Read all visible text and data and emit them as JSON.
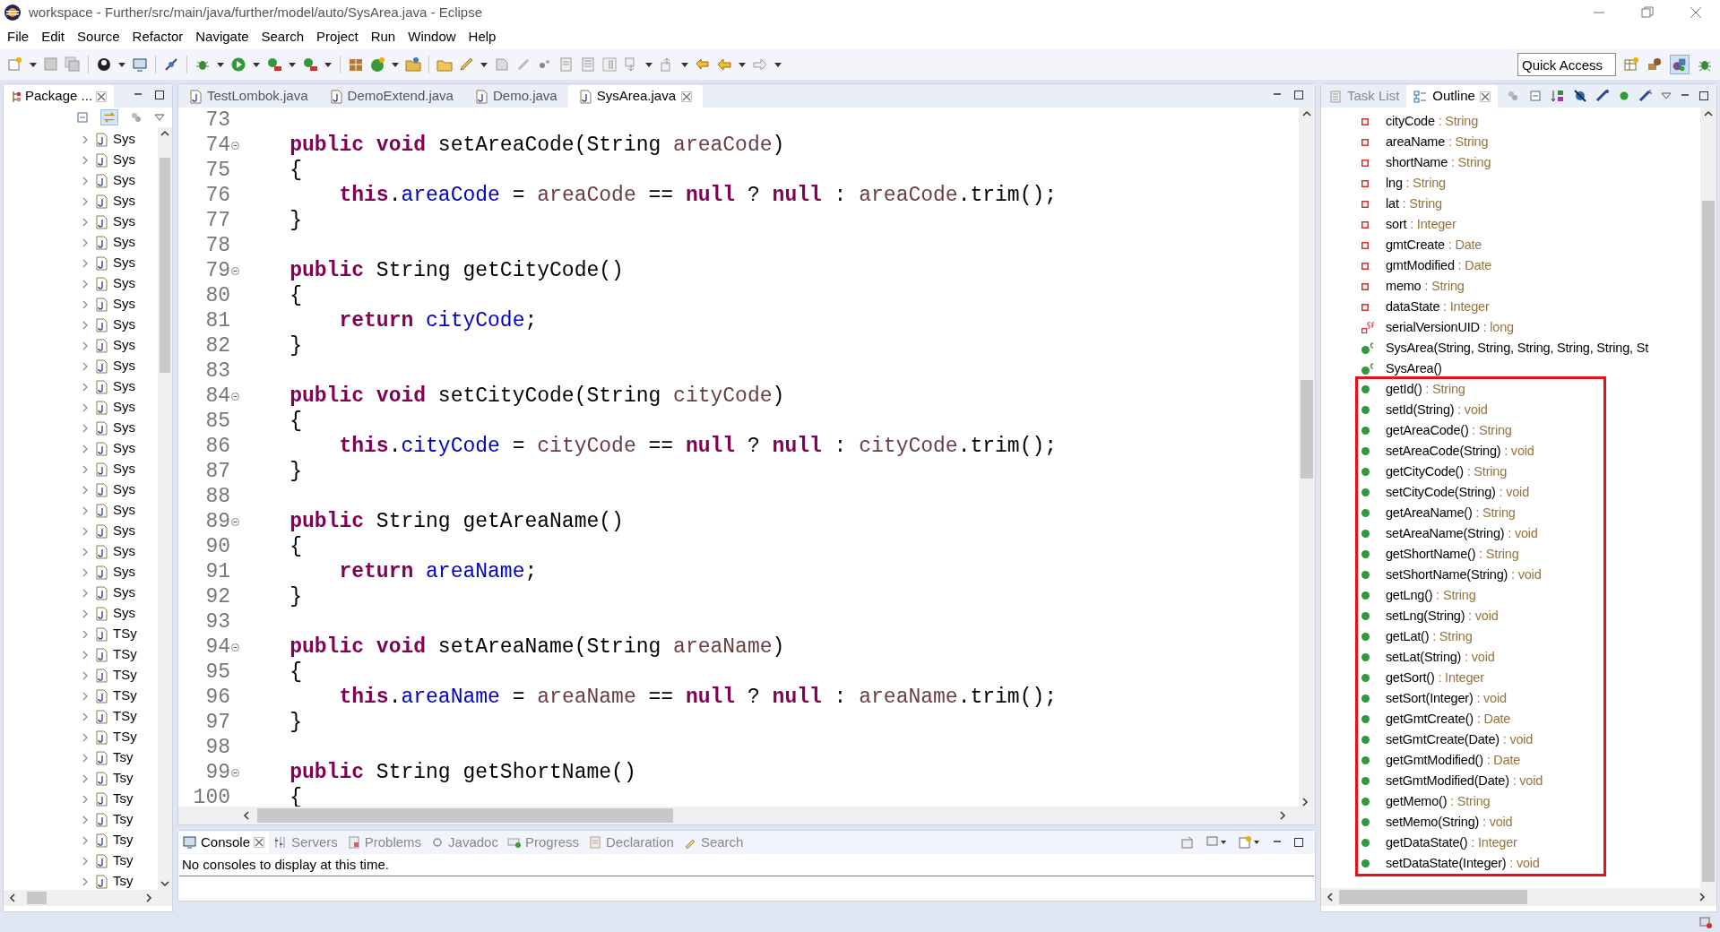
{
  "window": {
    "title": "workspace - Further/src/main/java/further/model/auto/SysArea.java - Eclipse"
  },
  "menu": [
    "File",
    "Edit",
    "Source",
    "Refactor",
    "Navigate",
    "Search",
    "Project",
    "Run",
    "Window",
    "Help"
  ],
  "quick_access": {
    "placeholder": "Quick Access"
  },
  "package_explorer": {
    "tab": {
      "label": "Package ...",
      "selected": true
    },
    "items": [
      "Sys",
      "Sys",
      "Sys",
      "Sys",
      "Sys",
      "Sys",
      "Sys",
      "Sys",
      "Sys",
      "Sys",
      "Sys",
      "Sys",
      "Sys",
      "Sys",
      "Sys",
      "Sys",
      "Sys",
      "Sys",
      "Sys",
      "Sys",
      "Sys",
      "Sys",
      "Sys",
      "Sys",
      "TSy",
      "TSy",
      "TSy",
      "TSy",
      "TSy",
      "TSy",
      "Tsy",
      "Tsy",
      "Tsy",
      "Tsy",
      "Tsy",
      "Tsy",
      "Tsy"
    ]
  },
  "editor": {
    "tabs": [
      {
        "label": "TestLombok.java",
        "selected": false
      },
      {
        "label": "DemoExtend.java",
        "selected": false
      },
      {
        "label": "Demo.java",
        "selected": false
      },
      {
        "label": "SysArea.java",
        "selected": true
      }
    ],
    "lines": [
      {
        "number": "73",
        "fold": false
      },
      {
        "number": "74",
        "fold": true,
        "tokens": [
          {
            "kind": "kw",
            "text": "    public"
          },
          {
            "kind": "kw",
            "text": " void"
          },
          {
            "kind": "plain",
            "text": " setAreaCode(String "
          },
          {
            "kind": "param",
            "text": "areaCode"
          },
          {
            "kind": "plain",
            "text": ")"
          }
        ]
      },
      {
        "number": "75",
        "fold": false,
        "tokens": [
          {
            "kind": "plain",
            "text": "    {"
          }
        ]
      },
      {
        "number": "76",
        "fold": false,
        "tokens": [
          {
            "kind": "kw",
            "text": "        this"
          },
          {
            "kind": "plain",
            "text": "."
          },
          {
            "kind": "field",
            "text": "areaCode"
          },
          {
            "kind": "plain",
            "text": " = "
          },
          {
            "kind": "param",
            "text": "areaCode"
          },
          {
            "kind": "plain",
            "text": " == "
          },
          {
            "kind": "kw",
            "text": "null"
          },
          {
            "kind": "plain",
            "text": " ? "
          },
          {
            "kind": "kw",
            "text": "null"
          },
          {
            "kind": "plain",
            "text": " : "
          },
          {
            "kind": "param",
            "text": "areaCode"
          },
          {
            "kind": "plain",
            "text": ".trim();"
          }
        ]
      },
      {
        "number": "77",
        "fold": false,
        "tokens": [
          {
            "kind": "plain",
            "text": "    }"
          }
        ]
      },
      {
        "number": "78",
        "fold": false
      },
      {
        "number": "79",
        "fold": true,
        "tokens": [
          {
            "kind": "kw",
            "text": "    public"
          },
          {
            "kind": "plain",
            "text": " String getCityCode()"
          }
        ]
      },
      {
        "number": "80",
        "fold": false,
        "tokens": [
          {
            "kind": "plain",
            "text": "    {"
          }
        ]
      },
      {
        "number": "81",
        "fold": false,
        "tokens": [
          {
            "kind": "kw",
            "text": "        return"
          },
          {
            "kind": "field",
            "text": " cityCode"
          },
          {
            "kind": "plain",
            "text": ";"
          }
        ]
      },
      {
        "number": "82",
        "fold": false,
        "tokens": [
          {
            "kind": "plain",
            "text": "    }"
          }
        ]
      },
      {
        "number": "83",
        "fold": false
      },
      {
        "number": "84",
        "fold": true,
        "tokens": [
          {
            "kind": "kw",
            "text": "    public"
          },
          {
            "kind": "kw",
            "text": " void"
          },
          {
            "kind": "plain",
            "text": " setCityCode(String "
          },
          {
            "kind": "param",
            "text": "cityCode"
          },
          {
            "kind": "plain",
            "text": ")"
          }
        ]
      },
      {
        "number": "85",
        "fold": false,
        "tokens": [
          {
            "kind": "plain",
            "text": "    {"
          }
        ]
      },
      {
        "number": "86",
        "fold": false,
        "tokens": [
          {
            "kind": "kw",
            "text": "        this"
          },
          {
            "kind": "plain",
            "text": "."
          },
          {
            "kind": "field",
            "text": "cityCode"
          },
          {
            "kind": "plain",
            "text": " = "
          },
          {
            "kind": "param",
            "text": "cityCode"
          },
          {
            "kind": "plain",
            "text": " == "
          },
          {
            "kind": "kw",
            "text": "null"
          },
          {
            "kind": "plain",
            "text": " ? "
          },
          {
            "kind": "kw",
            "text": "null"
          },
          {
            "kind": "plain",
            "text": " : "
          },
          {
            "kind": "param",
            "text": "cityCode"
          },
          {
            "kind": "plain",
            "text": ".trim();"
          }
        ]
      },
      {
        "number": "87",
        "fold": false,
        "tokens": [
          {
            "kind": "plain",
            "text": "    }"
          }
        ]
      },
      {
        "number": "88",
        "fold": false
      },
      {
        "number": "89",
        "fold": true,
        "tokens": [
          {
            "kind": "kw",
            "text": "    public"
          },
          {
            "kind": "plain",
            "text": " String getAreaName()"
          }
        ]
      },
      {
        "number": "90",
        "fold": false,
        "tokens": [
          {
            "kind": "plain",
            "text": "    {"
          }
        ]
      },
      {
        "number": "91",
        "fold": false,
        "tokens": [
          {
            "kind": "kw",
            "text": "        return"
          },
          {
            "kind": "field",
            "text": " areaName"
          },
          {
            "kind": "plain",
            "text": ";"
          }
        ]
      },
      {
        "number": "92",
        "fold": false,
        "tokens": [
          {
            "kind": "plain",
            "text": "    }"
          }
        ]
      },
      {
        "number": "93",
        "fold": false
      },
      {
        "number": "94",
        "fold": true,
        "tokens": [
          {
            "kind": "kw",
            "text": "    public"
          },
          {
            "kind": "kw",
            "text": " void"
          },
          {
            "kind": "plain",
            "text": " setAreaName(String "
          },
          {
            "kind": "param",
            "text": "areaName"
          },
          {
            "kind": "plain",
            "text": ")"
          }
        ]
      },
      {
        "number": "95",
        "fold": false,
        "tokens": [
          {
            "kind": "plain",
            "text": "    {"
          }
        ]
      },
      {
        "number": "96",
        "fold": false,
        "tokens": [
          {
            "kind": "kw",
            "text": "        this"
          },
          {
            "kind": "plain",
            "text": "."
          },
          {
            "kind": "field",
            "text": "areaName"
          },
          {
            "kind": "plain",
            "text": " = "
          },
          {
            "kind": "param",
            "text": "areaName"
          },
          {
            "kind": "plain",
            "text": " == "
          },
          {
            "kind": "kw",
            "text": "null"
          },
          {
            "kind": "plain",
            "text": " ? "
          },
          {
            "kind": "kw",
            "text": "null"
          },
          {
            "kind": "plain",
            "text": " : "
          },
          {
            "kind": "param",
            "text": "areaName"
          },
          {
            "kind": "plain",
            "text": ".trim();"
          }
        ]
      },
      {
        "number": "97",
        "fold": false,
        "tokens": [
          {
            "kind": "plain",
            "text": "    }"
          }
        ]
      },
      {
        "number": "98",
        "fold": false
      },
      {
        "number": "99",
        "fold": true,
        "tokens": [
          {
            "kind": "kw",
            "text": "    public"
          },
          {
            "kind": "plain",
            "text": " String getShortName()"
          }
        ]
      },
      {
        "number": "100",
        "fold": false,
        "tokens": [
          {
            "kind": "plain",
            "text": "    {"
          }
        ]
      }
    ]
  },
  "bottom_panel": {
    "tabs": [
      {
        "label": "Console",
        "selected": true
      },
      {
        "label": "Servers",
        "selected": false
      },
      {
        "label": "Problems",
        "selected": false
      },
      {
        "label": "Javadoc",
        "selected": false
      },
      {
        "label": "Progress",
        "selected": false
      },
      {
        "label": "Declaration",
        "selected": false
      },
      {
        "label": "Search",
        "selected": false
      }
    ],
    "message": "No consoles to display at this time."
  },
  "outline": {
    "tabs": [
      {
        "label": "Task List",
        "selected": false
      },
      {
        "label": "Outline",
        "selected": true
      }
    ],
    "items": [
      {
        "kind": "field",
        "name": "cityCode",
        "type": ": String",
        "highlighted": false
      },
      {
        "kind": "field",
        "name": "areaName",
        "type": ": String",
        "highlighted": false
      },
      {
        "kind": "field",
        "name": "shortName",
        "type": ": String",
        "highlighted": false
      },
      {
        "kind": "field",
        "name": "lng",
        "type": ": String",
        "highlighted": false
      },
      {
        "kind": "field",
        "name": "lat",
        "type": ": String",
        "highlighted": false
      },
      {
        "kind": "field",
        "name": "sort",
        "type": ": Integer",
        "highlighted": false
      },
      {
        "kind": "field",
        "name": "gmtCreate",
        "type": ": Date",
        "highlighted": false
      },
      {
        "kind": "field",
        "name": "gmtModified",
        "type": ": Date",
        "highlighted": false
      },
      {
        "kind": "field",
        "name": "memo",
        "type": ": String",
        "highlighted": false
      },
      {
        "kind": "field",
        "name": "dataState",
        "type": ": Integer",
        "highlighted": false
      },
      {
        "kind": "constant",
        "name": "serialVersionUID",
        "type": ": long",
        "highlighted": false
      },
      {
        "kind": "constructor",
        "name": "SysArea(String, String, String, String, String, St",
        "highlighted": false
      },
      {
        "kind": "constructor",
        "name": "SysArea()",
        "highlighted": false
      },
      {
        "kind": "method",
        "name": "getId()",
        "type": ": String",
        "highlighted": true
      },
      {
        "kind": "method",
        "name": "setId(String)",
        "type": ": void",
        "highlighted": true
      },
      {
        "kind": "method",
        "name": "getAreaCode()",
        "type": ": String",
        "highlighted": true
      },
      {
        "kind": "method",
        "name": "setAreaCode(String)",
        "type": ": void",
        "highlighted": true
      },
      {
        "kind": "method",
        "name": "getCityCode()",
        "type": ": String",
        "highlighted": true
      },
      {
        "kind": "method",
        "name": "setCityCode(String)",
        "type": ": void",
        "highlighted": true
      },
      {
        "kind": "method",
        "name": "getAreaName()",
        "type": ": String",
        "highlighted": true
      },
      {
        "kind": "method",
        "name": "setAreaName(String)",
        "type": ": void",
        "highlighted": true
      },
      {
        "kind": "method",
        "name": "getShortName()",
        "type": ": String",
        "highlighted": true
      },
      {
        "kind": "method",
        "name": "setShortName(String)",
        "type": ": void",
        "highlighted": true
      },
      {
        "kind": "method",
        "name": "getLng()",
        "type": ": String",
        "highlighted": true
      },
      {
        "kind": "method",
        "name": "setLng(String)",
        "type": ": void",
        "highlighted": true
      },
      {
        "kind": "method",
        "name": "getLat()",
        "type": ": String",
        "highlighted": true
      },
      {
        "kind": "method",
        "name": "setLat(String)",
        "type": ": void",
        "highlighted": true
      },
      {
        "kind": "method",
        "name": "getSort()",
        "type": ": Integer",
        "highlighted": true
      },
      {
        "kind": "method",
        "name": "setSort(Integer)",
        "type": ": void",
        "highlighted": true
      },
      {
        "kind": "method",
        "name": "getGmtCreate()",
        "type": ": Date",
        "highlighted": true
      },
      {
        "kind": "method",
        "name": "setGmtCreate(Date)",
        "type": ": void",
        "highlighted": true
      },
      {
        "kind": "method",
        "name": "getGmtModified()",
        "type": ": Date",
        "highlighted": true
      },
      {
        "kind": "method",
        "name": "setGmtModified(Date)",
        "type": ": void",
        "highlighted": true
      },
      {
        "kind": "method",
        "name": "getMemo()",
        "type": ": String",
        "highlighted": true
      },
      {
        "kind": "method",
        "name": "setMemo(String)",
        "type": ": void",
        "highlighted": true
      },
      {
        "kind": "method",
        "name": "getDataState()",
        "type": ": Integer",
        "highlighted": true
      },
      {
        "kind": "method",
        "name": "setDataState(Integer)",
        "type": ": void",
        "highlighted": true
      }
    ]
  }
}
